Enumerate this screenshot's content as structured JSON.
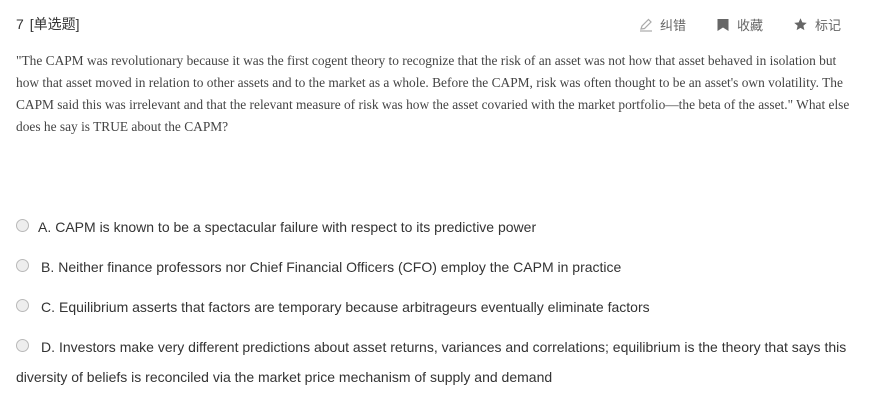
{
  "question": {
    "number": "7",
    "type_tag": "[单选题]",
    "stem": "\"The CAPM was revolutionary because it was the first cogent theory to recognize that the risk of an asset was not how that asset behaved in isolation but how that asset moved in relation to other assets and to the market as a whole. Before the CAPM, risk was often thought to be an asset's own volatility. The CAPM said this was irrelevant and that the relevant measure of risk was how the asset covaried with the market portfolio—the beta of the asset.\" What else does he say is TRUE about the CAPM?"
  },
  "toolbar": {
    "correct_label": "纠错",
    "correct_icon": "pencil-icon",
    "favorite_label": "收藏",
    "favorite_icon": "bookmark-icon",
    "mark_label": "标记",
    "mark_icon": "star-icon"
  },
  "options": [
    {
      "letter": "A.",
      "text": "CAPM is known to be a spectacular failure with respect to its predictive power"
    },
    {
      "letter": "B.",
      "text": "Neither finance professors nor Chief Financial Officers (CFO) employ the CAPM in practice"
    },
    {
      "letter": "C.",
      "text": "Equilibrium asserts that factors are temporary because arbitrageurs eventually eliminate factors"
    },
    {
      "letter": "D.",
      "text": "Investors make very different predictions about asset returns, variances and correlations; equilibrium is the theory that says this diversity of beliefs is reconciled via the market price mechanism of supply and demand"
    }
  ],
  "colors": {
    "text": "#333333",
    "muted": "#666666",
    "icon": "#999999"
  }
}
